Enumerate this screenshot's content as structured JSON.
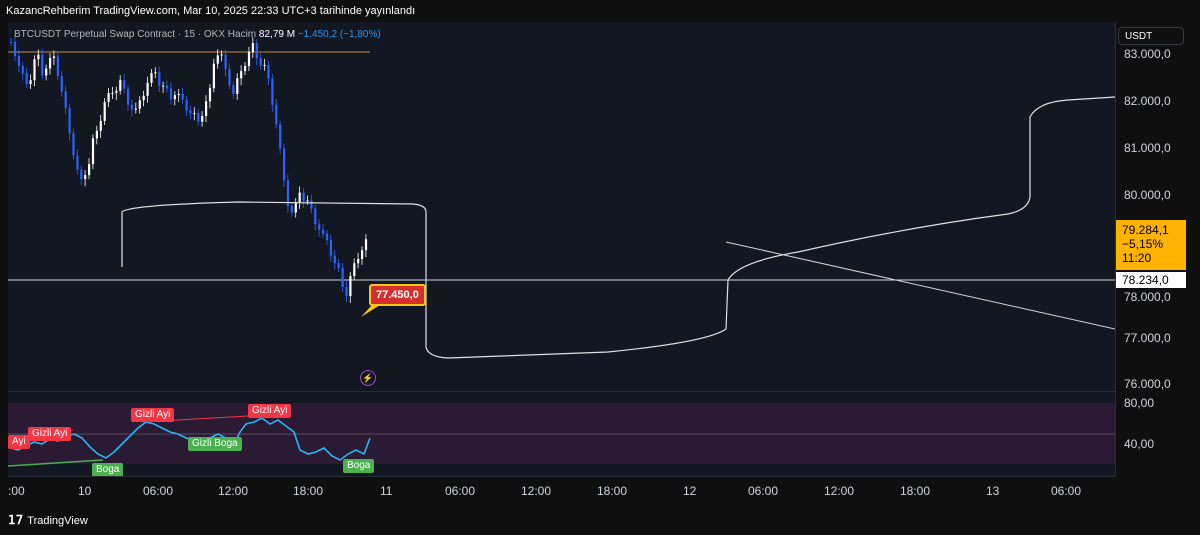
{
  "header": {
    "publish_line": "KazancRehberim TradingView.com, Mar 10, 2025 22:33 UTC+3 tarihinde yayınlandı"
  },
  "legend": {
    "symbol": "BTCUSDT Perpetual Swap Contract · 15 · OKX",
    "volume_label": "Hacim",
    "volume_value": "82,79 M",
    "change": "−1.450,2 (−1,80%)"
  },
  "price_axis": {
    "currency_button": "USDT",
    "labels": [
      "83.000,0",
      "82.000,0",
      "81.000,0",
      "80.000,0",
      "78.000,0",
      "77.000,0",
      "76.000,0"
    ],
    "current_price": "79.284,1",
    "current_change": "−5,15%",
    "countdown": "11:20",
    "horizontal_line_price": "78.234,0"
  },
  "osc_axis": {
    "labels": [
      "80,00",
      "40,00"
    ]
  },
  "annotations": {
    "price_tag": "77.450,0",
    "osc_labels": [
      {
        "text": "Ayi",
        "kind": "bear"
      },
      {
        "text": "Gizli Ayi",
        "kind": "bear"
      },
      {
        "text": "Gizli Ayi",
        "kind": "bear"
      },
      {
        "text": "Gizli Ayi",
        "kind": "bear"
      },
      {
        "text": "Gizli Boga",
        "kind": "bull"
      },
      {
        "text": "Boga",
        "kind": "bull"
      },
      {
        "text": "Boga",
        "kind": "bull"
      }
    ]
  },
  "time_axis": {
    "labels": [
      ":00",
      "10",
      "06:00",
      "12:00",
      "18:00",
      "11",
      "06:00",
      "12:00",
      "18:00",
      "12",
      "06:00",
      "12:00",
      "18:00",
      "13",
      "06:00"
    ]
  },
  "footer": {
    "brand": "TradingView"
  },
  "colors": {
    "background": "#131722",
    "bull_candle": "#ffffff",
    "bear_candle": "#2962ff",
    "current_price_bg": "#ffb300",
    "osc_line": "#29b6f6",
    "osc_band": "#2a1a33"
  }
}
